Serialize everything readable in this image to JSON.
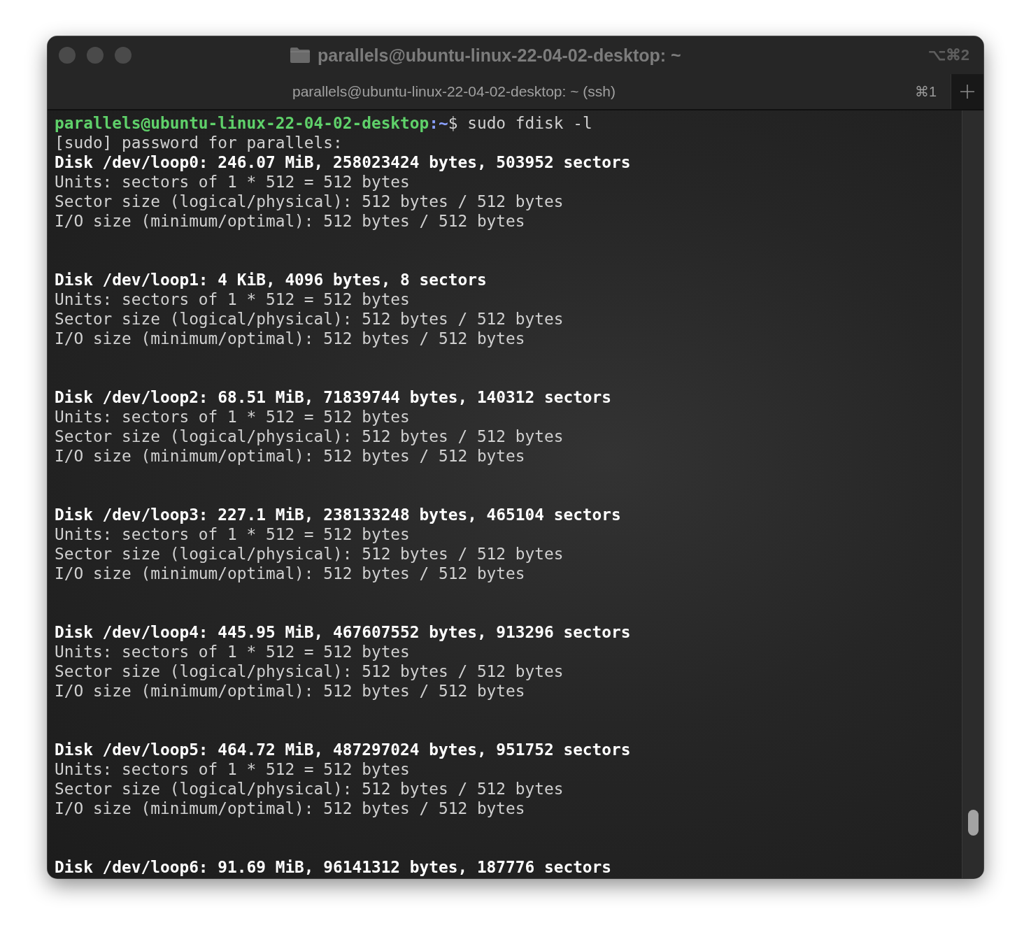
{
  "window": {
    "title": "parallels@ubuntu-linux-22-04-02-desktop: ~",
    "shortcut": "⌥⌘2"
  },
  "tabs": [
    {
      "label": "parallels@ubuntu-linux-22-04-02-desktop: ~ (ssh)",
      "shortcut": "⌘1",
      "selected": true
    }
  ],
  "terminal": {
    "lines": [
      {
        "kind": "prompt",
        "user_host": "parallels@ubuntu-linux-22-04-02-desktop",
        "path": ":~",
        "symbol": "$",
        "command": " sudo fdisk -l"
      },
      {
        "kind": "text",
        "text": "[sudo] password for parallels:"
      },
      {
        "kind": "heading",
        "text": "Disk /dev/loop0: 246.07 MiB, 258023424 bytes, 503952 sectors"
      },
      {
        "kind": "text",
        "text": "Units: sectors of 1 * 512 = 512 bytes"
      },
      {
        "kind": "text",
        "text": "Sector size (logical/physical): 512 bytes / 512 bytes"
      },
      {
        "kind": "text",
        "text": "I/O size (minimum/optimal): 512 bytes / 512 bytes"
      },
      {
        "kind": "blank"
      },
      {
        "kind": "blank"
      },
      {
        "kind": "heading",
        "text": "Disk /dev/loop1: 4 KiB, 4096 bytes, 8 sectors"
      },
      {
        "kind": "text",
        "text": "Units: sectors of 1 * 512 = 512 bytes"
      },
      {
        "kind": "text",
        "text": "Sector size (logical/physical): 512 bytes / 512 bytes"
      },
      {
        "kind": "text",
        "text": "I/O size (minimum/optimal): 512 bytes / 512 bytes"
      },
      {
        "kind": "blank"
      },
      {
        "kind": "blank"
      },
      {
        "kind": "heading",
        "text": "Disk /dev/loop2: 68.51 MiB, 71839744 bytes, 140312 sectors"
      },
      {
        "kind": "text",
        "text": "Units: sectors of 1 * 512 = 512 bytes"
      },
      {
        "kind": "text",
        "text": "Sector size (logical/physical): 512 bytes / 512 bytes"
      },
      {
        "kind": "text",
        "text": "I/O size (minimum/optimal): 512 bytes / 512 bytes"
      },
      {
        "kind": "blank"
      },
      {
        "kind": "blank"
      },
      {
        "kind": "heading",
        "text": "Disk /dev/loop3: 227.1 MiB, 238133248 bytes, 465104 sectors"
      },
      {
        "kind": "text",
        "text": "Units: sectors of 1 * 512 = 512 bytes"
      },
      {
        "kind": "text",
        "text": "Sector size (logical/physical): 512 bytes / 512 bytes"
      },
      {
        "kind": "text",
        "text": "I/O size (minimum/optimal): 512 bytes / 512 bytes"
      },
      {
        "kind": "blank"
      },
      {
        "kind": "blank"
      },
      {
        "kind": "heading",
        "text": "Disk /dev/loop4: 445.95 MiB, 467607552 bytes, 913296 sectors"
      },
      {
        "kind": "text",
        "text": "Units: sectors of 1 * 512 = 512 bytes"
      },
      {
        "kind": "text",
        "text": "Sector size (logical/physical): 512 bytes / 512 bytes"
      },
      {
        "kind": "text",
        "text": "I/O size (minimum/optimal): 512 bytes / 512 bytes"
      },
      {
        "kind": "blank"
      },
      {
        "kind": "blank"
      },
      {
        "kind": "heading",
        "text": "Disk /dev/loop5: 464.72 MiB, 487297024 bytes, 951752 sectors"
      },
      {
        "kind": "text",
        "text": "Units: sectors of 1 * 512 = 512 bytes"
      },
      {
        "kind": "text",
        "text": "Sector size (logical/physical): 512 bytes / 512 bytes"
      },
      {
        "kind": "text",
        "text": "I/O size (minimum/optimal): 512 bytes / 512 bytes"
      },
      {
        "kind": "blank"
      },
      {
        "kind": "blank"
      },
      {
        "kind": "heading",
        "text": "Disk /dev/loop6: 91.69 MiB, 96141312 bytes, 187776 sectors"
      }
    ]
  }
}
